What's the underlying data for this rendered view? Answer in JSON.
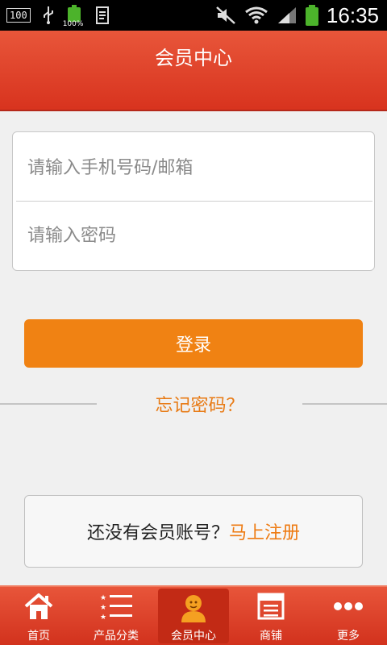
{
  "status_bar": {
    "badge": "100",
    "battery_small_pct": "100%",
    "time": "16:35"
  },
  "header": {
    "title": "会员中心"
  },
  "login": {
    "phone_placeholder": "请输入手机号码/邮箱",
    "password_placeholder": "请输入密码",
    "login_button": "登录",
    "forgot_password": "忘记密码？"
  },
  "register": {
    "question": "还没有会员账号？",
    "link": "马上注册"
  },
  "bottom_nav": {
    "items": [
      {
        "label": "首页",
        "icon": "home-icon"
      },
      {
        "label": "产品分类",
        "icon": "list-icon"
      },
      {
        "label": "会员中心",
        "icon": "user-icon",
        "active": true
      },
      {
        "label": "商铺",
        "icon": "shop-icon"
      },
      {
        "label": "更多",
        "icon": "more-icon"
      }
    ]
  },
  "colors": {
    "header_red": "#d8331e",
    "accent_orange": "#f08213",
    "link_orange": "#e87a14",
    "background": "#f0f0f0"
  }
}
